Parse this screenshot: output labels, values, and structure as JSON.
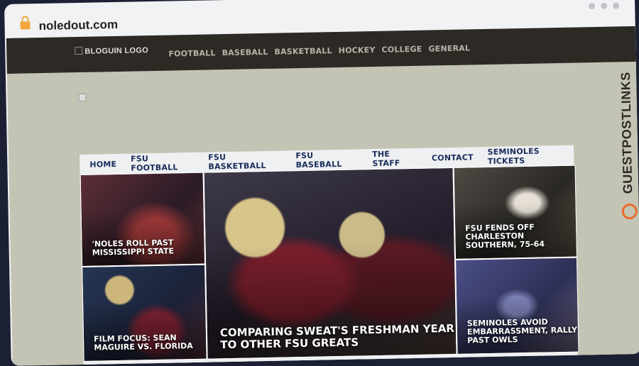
{
  "browser": {
    "url": "noledout.com"
  },
  "site": {
    "logo_alt": "BLOGUIN LOGO",
    "top_nav": [
      "FOOTBALL",
      "BASEBALL",
      "BASKETBALL",
      "HOCKEY",
      "COLLEGE",
      "GENERAL"
    ]
  },
  "fsu": {
    "nav": [
      "HOME",
      "FSU FOOTBALL",
      "FSU BASKETBALL",
      "FSU BASEBALL",
      "THE STAFF",
      "CONTACT",
      "SEMINOLES TICKETS"
    ],
    "tiles": [
      {
        "caption": "'Noles roll past Mississippi State"
      },
      {
        "caption": "Comparing Sweat's freshman year to other FSU greats"
      },
      {
        "caption": "FSU fends off Charleston Southern, 75-64"
      },
      {
        "caption": "Film Focus: Sean Maguire vs. Florida"
      },
      {
        "caption": "Seminoles avoid embarrassment, rally past Owls"
      }
    ]
  },
  "badge": {
    "text": "GUESTPOSTLINKS",
    "accent": "#e96b2c"
  }
}
